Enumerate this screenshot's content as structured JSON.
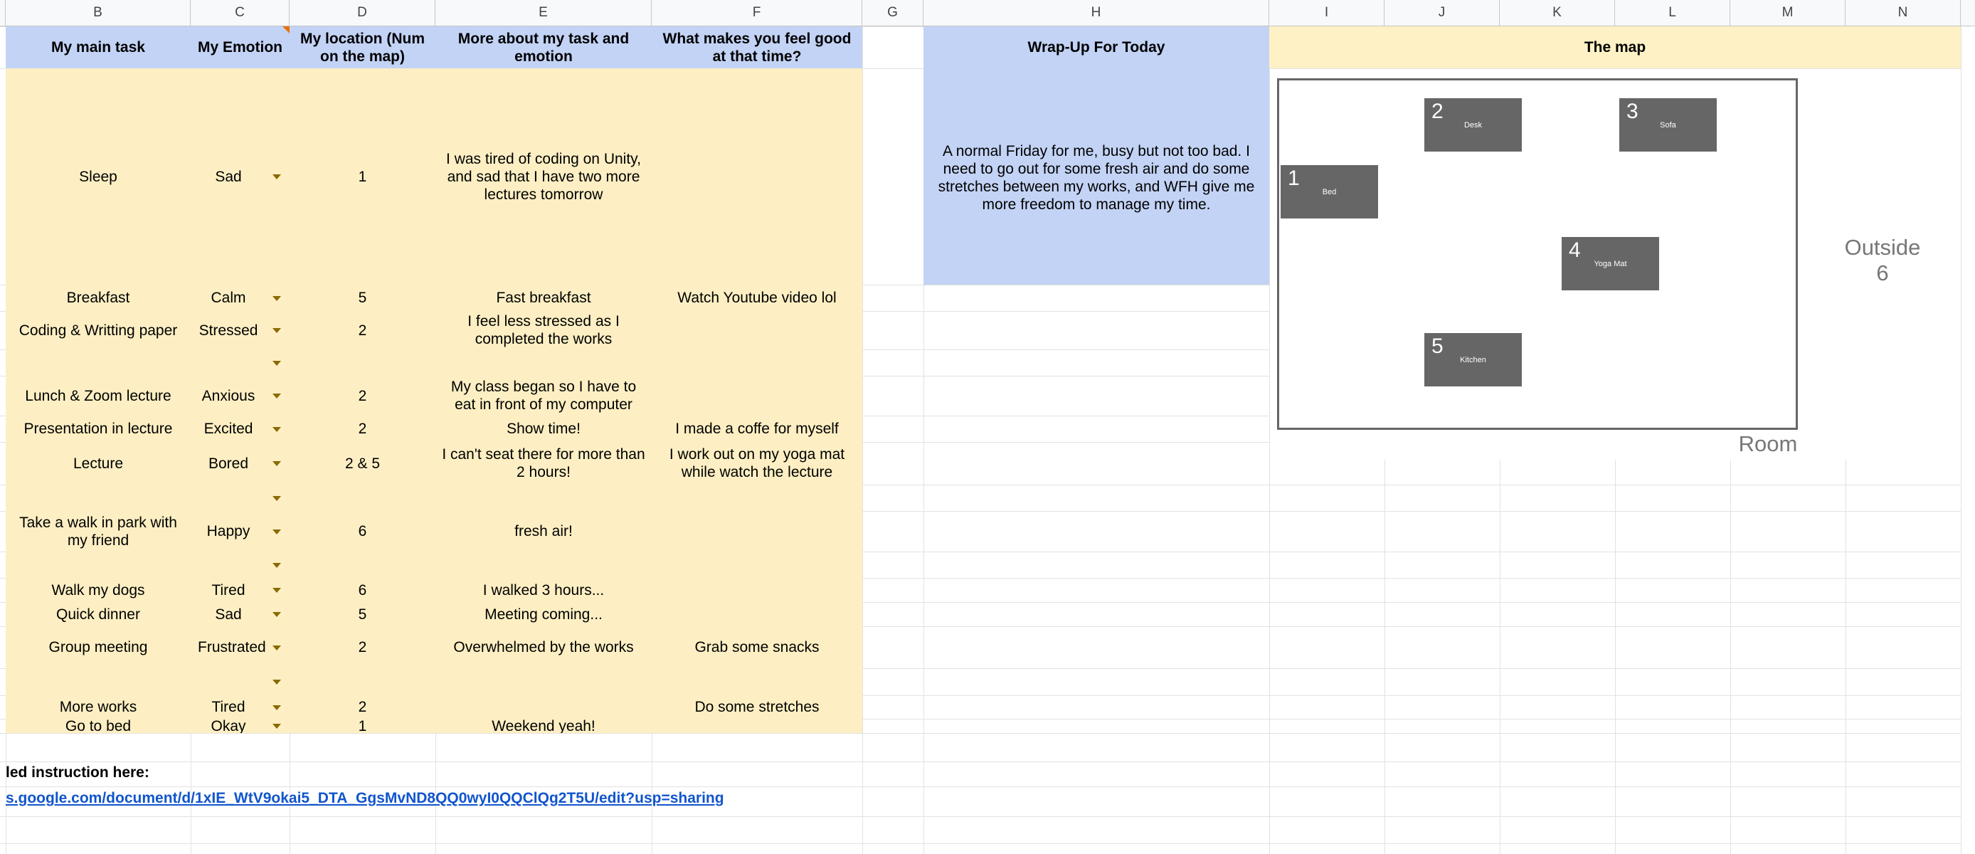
{
  "columns": [
    "B",
    "C",
    "D",
    "E",
    "F",
    "G",
    "H",
    "I",
    "J",
    "K",
    "L",
    "M",
    "N"
  ],
  "headers": {
    "main_task": "My main task",
    "emotion": "My Emotion",
    "location": "My location (Num on the map)",
    "more": "More about my task and emotion",
    "feel_good": "What makes you feel good at that time?",
    "wrap_up": "Wrap-Up For Today",
    "map": "The map"
  },
  "rows": [
    {
      "task": "Sleep",
      "emotion": "Sad",
      "location": "1",
      "more": "I was tired of coding on Unity, and sad that I have two more lectures tomorrow",
      "feel_good": ""
    },
    {
      "task": "Breakfast",
      "emotion": "Calm",
      "location": "5",
      "more": "Fast breakfast",
      "feel_good": "Watch Youtube video lol"
    },
    {
      "task": "Coding & Writting paper",
      "emotion": "Stressed",
      "location": "2",
      "more": "I feel less stressed as I completed the works",
      "feel_good": ""
    },
    {
      "task": "",
      "emotion": "",
      "location": "",
      "more": "",
      "feel_good": ""
    },
    {
      "task": "Lunch & Zoom lecture",
      "emotion": "Anxious",
      "location": "2",
      "more": "My class began so I have to eat in front of my computer",
      "feel_good": ""
    },
    {
      "task": "Presentation in lecture",
      "emotion": "Excited",
      "location": "2",
      "more": "Show time!",
      "feel_good": "I made a coffe for myself"
    },
    {
      "task": "Lecture",
      "emotion": "Bored",
      "location": "2 & 5",
      "more": "I can't seat there for more than 2 hours!",
      "feel_good": "I work out on my yoga mat while watch the lecture"
    },
    {
      "task": "",
      "emotion": "",
      "location": "",
      "more": "",
      "feel_good": ""
    },
    {
      "task": "Take a walk in park with my friend",
      "emotion": "Happy",
      "location": "6",
      "more": "fresh air!",
      "feel_good": ""
    },
    {
      "task": "",
      "emotion": "",
      "location": "",
      "more": "",
      "feel_good": ""
    },
    {
      "task": "Walk my dogs",
      "emotion": "Tired",
      "location": "6",
      "more": "I walked 3 hours...",
      "feel_good": ""
    },
    {
      "task": "Quick dinner",
      "emotion": "Sad",
      "location": "5",
      "more": "Meeting coming...",
      "feel_good": ""
    },
    {
      "task": "Group meeting",
      "emotion": "Frustrated",
      "location": "2",
      "more": "Overwhelmed by the works",
      "feel_good": "Grab some snacks"
    },
    {
      "task": "",
      "emotion": "",
      "location": "",
      "more": "",
      "feel_good": ""
    },
    {
      "task": "More works",
      "emotion": "Tired",
      "location": "2",
      "more": "",
      "feel_good": "Do some stretches"
    },
    {
      "task": "Go to bed",
      "emotion": "Okay",
      "location": "1",
      "more": "Weekend yeah!",
      "feel_good": ""
    }
  ],
  "wrap_up_text": "A normal Friday for me, busy but not too bad. I need to go out for some fresh air and do some stretches between my works, and WFH give me more freedom to manage my time.",
  "map": {
    "rooms": [
      {
        "num": "1",
        "name": "Bed"
      },
      {
        "num": "2",
        "name": "Desk"
      },
      {
        "num": "3",
        "name": "Sofa"
      },
      {
        "num": "4",
        "name": "Yoga Mat"
      },
      {
        "num": "5",
        "name": "Kitchen"
      }
    ],
    "outside_label": "Outside",
    "outside_num": "6",
    "room_label": "Room"
  },
  "footer": {
    "instruction": "led instruction here:",
    "link": "s.google.com/document/d/1xIE_WtV9okai5_DTA_GgsMvND8QQ0wyI0QQClQg2T5U/edit?usp=sharing"
  },
  "colors": {
    "yellow": "#fdefc3",
    "blue": "#c3d3f5",
    "map_header": "#fdf1c5",
    "room_box": "#666666",
    "link": "#1155cc"
  },
  "icons": [
    "dropdown-arrow-icon"
  ]
}
